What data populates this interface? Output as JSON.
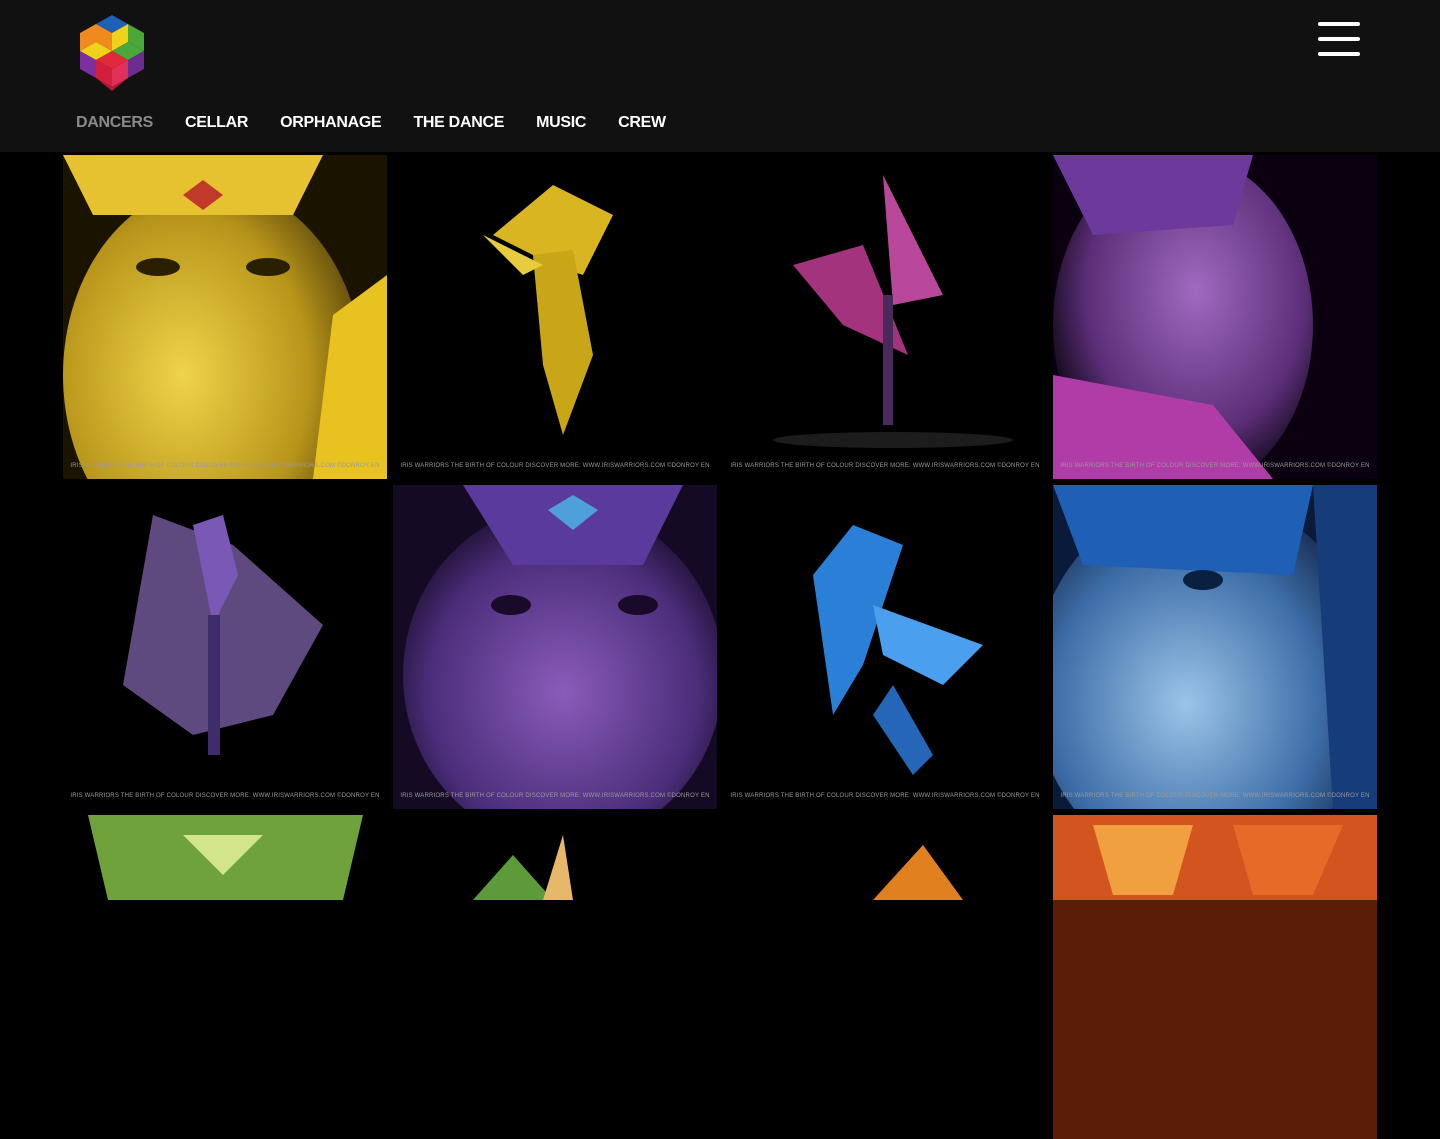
{
  "nav": {
    "items": [
      "DANCERS",
      "CELLAR",
      "ORPHANAGE",
      "THE DANCE",
      "MUSIC",
      "CREW"
    ],
    "active_index": 0
  },
  "gallery": {
    "caption": "IRIS WARRIORS THE BIRTH OF COLOUR  DISCOVER MORE: WWW.IRISWARRIORS.COM  ©DONROY EN",
    "tiles": [
      {
        "subject": "yellow-warrior-portrait",
        "color": "#d4b21c"
      },
      {
        "subject": "yellow-leaping-dancer",
        "color": "#e3c22a"
      },
      {
        "subject": "magenta-winged-dancer",
        "color": "#b03a8a"
      },
      {
        "subject": "purple-warrior-portrait",
        "color": "#8b4ea8"
      },
      {
        "subject": "violet-winged-dancer",
        "color": "#5b3f9a"
      },
      {
        "subject": "violet-warrior-portrait",
        "color": "#6a3f9e"
      },
      {
        "subject": "blue-leaping-dancer",
        "color": "#2f7fd8"
      },
      {
        "subject": "blue-warrior-portrait",
        "color": "#3e79c4"
      },
      {
        "subject": "green-warrior-portrait",
        "color": "#7fae3a"
      },
      {
        "subject": "green-dancer",
        "color": "#6aa63a"
      },
      {
        "subject": "orange-dancer",
        "color": "#e07a1e"
      },
      {
        "subject": "orange-warrior-portrait",
        "color": "#e0502a"
      }
    ]
  }
}
